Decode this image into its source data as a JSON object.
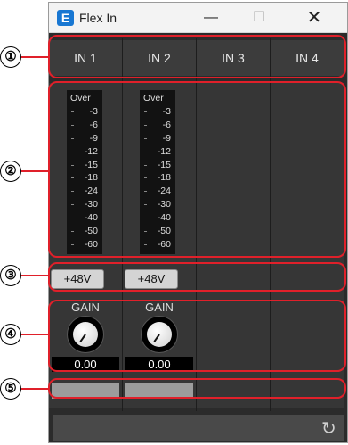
{
  "window": {
    "title": "Flex In",
    "app_icon_letter": "E",
    "min_glyph": "—",
    "max_glyph": "☐",
    "close_glyph": "✕"
  },
  "callouts": [
    "①",
    "②",
    "③",
    "④",
    "⑤"
  ],
  "channels": [
    {
      "label": "IN 1",
      "has_controls": true,
      "phantom_label": "+48V",
      "gain_label": "GAIN",
      "gain_value": "0.00"
    },
    {
      "label": "IN 2",
      "has_controls": true,
      "phantom_label": "+48V",
      "gain_label": "GAIN",
      "gain_value": "0.00"
    },
    {
      "label": "IN 3",
      "has_controls": false
    },
    {
      "label": "IN 4",
      "has_controls": false
    }
  ],
  "meter_scale": [
    "Over",
    "-3",
    "-6",
    "-9",
    "-12",
    "-15",
    "-18",
    "-24",
    "-30",
    "-40",
    "-50",
    "-60"
  ],
  "footer": {
    "refresh_icon": "↻"
  },
  "colors": {
    "highlight": "#e0202a",
    "panel": "#2b2b2b",
    "accent": "#1877d2"
  }
}
